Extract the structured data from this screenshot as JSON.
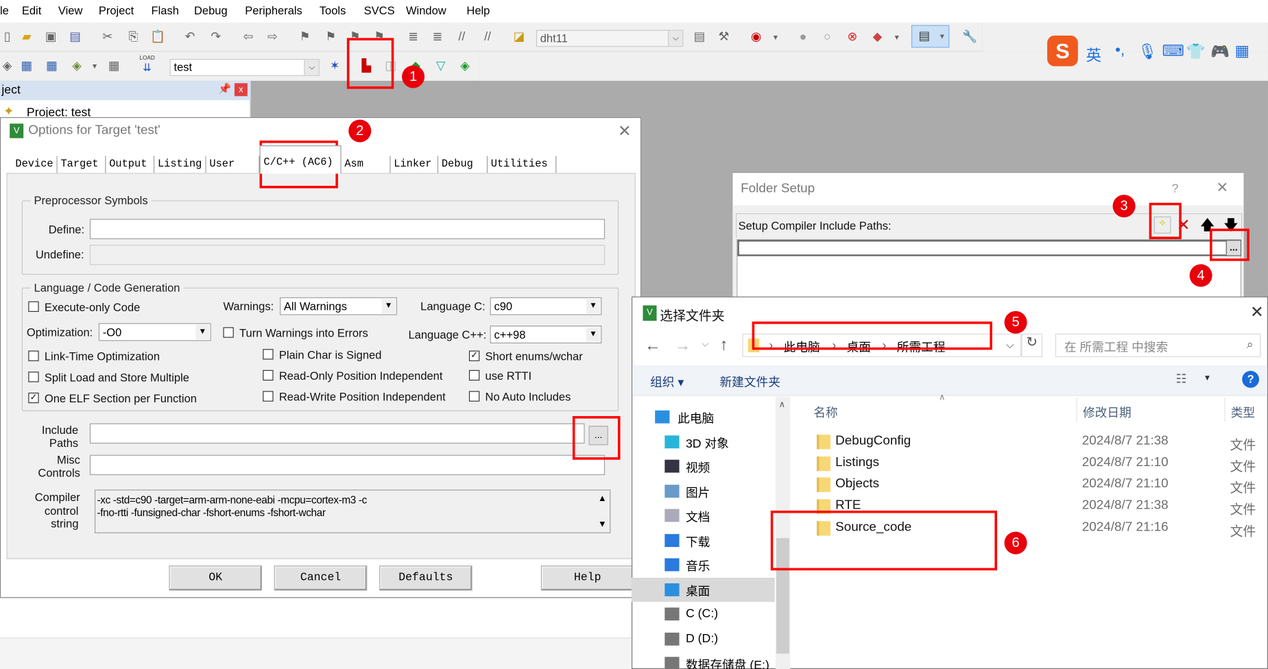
{
  "menu": [
    "le",
    "Edit",
    "View",
    "Project",
    "Flash",
    "Debug",
    "Peripherals",
    "Tools",
    "SVCS",
    "Window",
    "Help"
  ],
  "toolbar": {
    "target_combo": "dht11",
    "build_target": "test",
    "load_label": "LOAD"
  },
  "ime": {
    "logo": "S",
    "lang": "英"
  },
  "project_panel": {
    "title": "ject",
    "tree_root": "Project: test"
  },
  "options": {
    "title": "Options for Target 'test'",
    "tabs": [
      "Device",
      "Target",
      "Output",
      "Listing",
      "User",
      "C/C++ (AC6)",
      "Asm",
      "Linker",
      "Debug",
      "Utilities"
    ],
    "active_tab": "C/C++ (AC6)",
    "preprocessor": {
      "group": "Preprocessor Symbols",
      "define_label": "Define:",
      "define_value": "",
      "undefine_label": "Undefine:",
      "undefine_value": ""
    },
    "codegen": {
      "group": "Language / Code Generation",
      "warnings_label": "Warnings:",
      "warnings_value": "All Warnings",
      "language_c_label": "Language C:",
      "language_c_value": "c90",
      "optimization_label": "Optimization:",
      "optimization_value": "-O0",
      "language_cpp_label": "Language C++:",
      "language_cpp_value": "c++98",
      "checkboxes": [
        {
          "label": "Execute-only Code",
          "checked": false
        },
        {
          "label": "Turn Warnings into Errors",
          "checked": false
        },
        {
          "label": "Link-Time Optimization",
          "checked": false
        },
        {
          "label": "Plain Char is Signed",
          "checked": false
        },
        {
          "label": "Short enums/wchar",
          "checked": true
        },
        {
          "label": "Split Load and Store Multiple",
          "checked": false
        },
        {
          "label": "Read-Only Position Independent",
          "checked": false
        },
        {
          "label": "use RTTI",
          "checked": false
        },
        {
          "label": "One ELF Section per Function",
          "checked": true
        },
        {
          "label": "Read-Write Position Independent",
          "checked": false
        },
        {
          "label": "No Auto Includes",
          "checked": false
        }
      ]
    },
    "include_paths_label": [
      "Include",
      "Paths"
    ],
    "include_paths_value": "",
    "browse_label": "...",
    "misc_controls_label": [
      "Misc",
      "Controls"
    ],
    "misc_controls_value": "",
    "compiler_string_label": [
      "Compiler",
      "control",
      "string"
    ],
    "compiler_string_lines": [
      "-xc -std=c90 -target=arm-arm-none-eabi -mcpu=cortex-m3 -c",
      "-fno-rtti -funsigned-char -fshort-enums -fshort-wchar"
    ],
    "buttons": {
      "ok": "OK",
      "cancel": "Cancel",
      "defaults": "Defaults",
      "help": "Help"
    }
  },
  "folder_setup": {
    "title": "Folder Setup",
    "help": "?",
    "header": "Setup Compiler Include Paths:",
    "browse_label": "...",
    "path_value": ""
  },
  "select_folder": {
    "title": "选择文件夹",
    "breadcrumb": [
      "此电脑",
      "桌面",
      "所需工程"
    ],
    "search_placeholder": "在 所需工程 中搜索",
    "organize": "组织 ▾",
    "new_folder": "新建文件夹",
    "nav": [
      {
        "label": "此电脑",
        "icon": "pc-icon",
        "indent": 0
      },
      {
        "label": "3D 对象",
        "icon": "3d-objects-icon",
        "indent": 1
      },
      {
        "label": "视频",
        "icon": "video-icon",
        "indent": 1
      },
      {
        "label": "图片",
        "icon": "pictures-icon",
        "indent": 1
      },
      {
        "label": "文档",
        "icon": "documents-icon",
        "indent": 1
      },
      {
        "label": "下载",
        "icon": "download-icon",
        "indent": 1
      },
      {
        "label": "音乐",
        "icon": "music-icon",
        "indent": 1
      },
      {
        "label": "桌面",
        "icon": "desktop-icon",
        "indent": 1,
        "selected": true
      },
      {
        "label": "C (C:)",
        "icon": "drive-icon",
        "indent": 1
      },
      {
        "label": "D (D:)",
        "icon": "drive-icon",
        "indent": 1
      },
      {
        "label": "数据存储盘 (E:)",
        "icon": "drive-icon",
        "indent": 1
      }
    ],
    "columns": [
      "名称",
      "修改日期",
      "类型"
    ],
    "files": [
      {
        "name": "DebugConfig",
        "date": "2024/8/7 21:38",
        "type": "文件夹"
      },
      {
        "name": "Listings",
        "date": "2024/8/7 21:10",
        "type": "文件夹"
      },
      {
        "name": "Objects",
        "date": "2024/8/7 21:10",
        "type": "文件夹"
      },
      {
        "name": "RTE",
        "date": "2024/8/7 21:38",
        "type": "文件夹"
      },
      {
        "name": "Source_code",
        "date": "2024/8/7 21:16",
        "type": "文件夹"
      }
    ]
  },
  "annotations": [
    "1",
    "2",
    "3",
    "4",
    "5",
    "6"
  ],
  "colors": {
    "annotation_red": "#ff0000",
    "badge_red": "#e8000b",
    "folder_yellow": "#f8d775"
  }
}
